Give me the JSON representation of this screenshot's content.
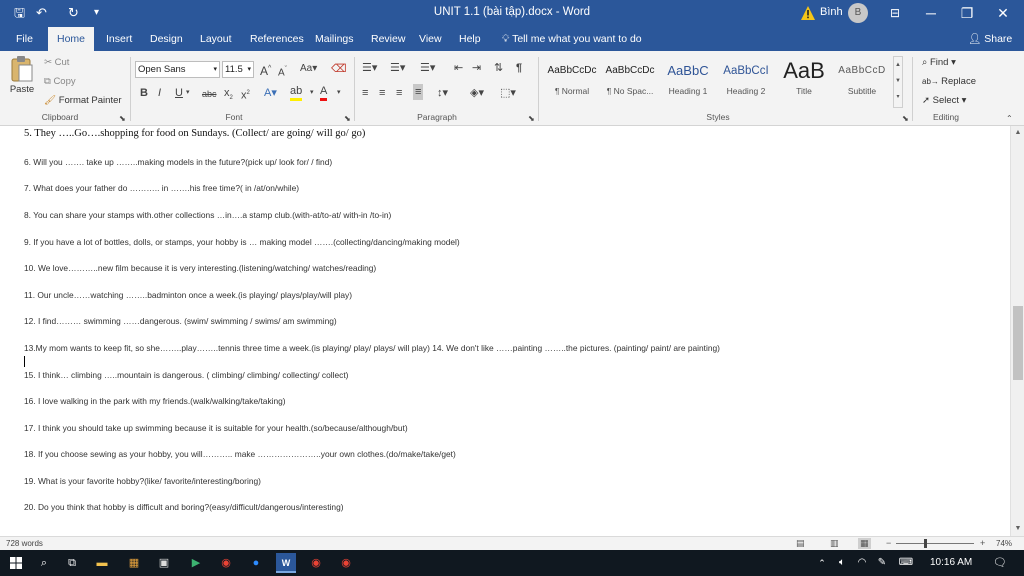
{
  "window": {
    "title": "UNIT 1.1 (bài tập).docx  -  Word",
    "user": "Bình",
    "avatar_initial": "B",
    "minimize": "─",
    "maximize": "❐",
    "close": "✕",
    "restore_layout": "⊟"
  },
  "quick_access": {
    "save": "🖫",
    "undo": "↶",
    "redo": "↻",
    "more": "▾"
  },
  "menu": {
    "tabs": [
      "File",
      "Home",
      "Insert",
      "Design",
      "Layout",
      "References",
      "Mailings",
      "Review",
      "View",
      "Help"
    ],
    "active": "Home",
    "tell_me": "Tell me what you want to do",
    "share": "Share"
  },
  "ribbon": {
    "clipboard": {
      "paste": "Paste",
      "cut": "Cut",
      "copy": "Copy",
      "format_painter": "Format Painter",
      "label": "Clipboard"
    },
    "font": {
      "name": "Open Sans",
      "size": "11.5",
      "label": "Font"
    },
    "paragraph": {
      "label": "Paragraph"
    },
    "styles": {
      "label": "Styles",
      "items": [
        {
          "preview": "AaBbCcDc",
          "name": "¶ Normal"
        },
        {
          "preview": "AaBbCcDc",
          "name": "¶ No Spac..."
        },
        {
          "preview": "AaBbC",
          "name": "Heading 1"
        },
        {
          "preview": "AaBbCcI",
          "name": "Heading 2"
        },
        {
          "preview": "AaB",
          "name": "Title"
        },
        {
          "preview": "AaBbCcD",
          "name": "Subtitle"
        }
      ]
    },
    "editing": {
      "find": "Find",
      "replace": "Replace",
      "select": "Select",
      "label": "Editing"
    }
  },
  "document": {
    "lines": [
      "5. They …..Go….shopping for food on Sundays. (Collect/ are going/ will go/ go)",
      "6. Will you ……. take up ……..making models in the future?(pick up/ look for/  / find)",
      "7. What does your father do ……….. in …….his free time?( in /at/on/while)",
      "8. You can share your stamps with.other collections …in….a stamp club.(with-at/to-at/ with-in /to-in)",
      "9. If you have a lot of bottles, dolls, or stamps, your hobby is … making model …….(collecting/dancing/making model)",
      "10. We love………..new film because it is very interesting.(listening/watching/ watches/reading)",
      "11. Our uncle……watching ……..badminton once a week.(is playing/ plays/play/will play)",
      "12. I find……… swimming ……dangerous. (swim/ swimming / swims/ am swimming)",
      "13.My mom wants to keep fit, so she……..play……..tennis three time a week.(is playing/ play/ plays/ will play) 14. We don't like ……painting ……..the pictures. (painting/ paint/ are painting)",
      "15. I think… climbing …..mountain is dangerous. ( climbing/ climbing/ collecting/ collect)",
      "16. I love  walking  in the park with my friends.(walk/walking/take/taking)",
      "17. I think you should take up swimming  because  it is suitable for your health.(so/because/although/but)",
      "18. If you choose sewing as your hobby, you will……….. make …………………..your own clothes.(do/make/take/get)",
      "19. What is your  favorite  hobby?(like/ favorite/interesting/boring)",
      "20. Do you think that hobby is  difficult and boring?(easy/difficult/dangerous/interesting)"
    ]
  },
  "status": {
    "word_count": "728 words",
    "zoom": "74%"
  },
  "taskbar": {
    "time": "10:16 AM"
  }
}
